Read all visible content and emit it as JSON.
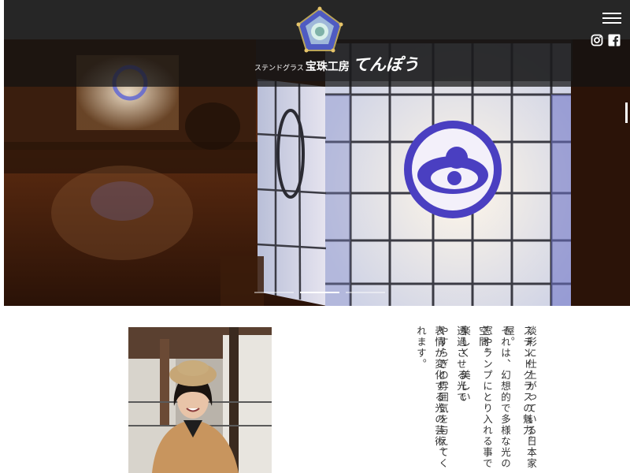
{
  "header": {
    "logo_small": "ステンドグラス",
    "logo_mid": "宝珠工房",
    "logo_big": "てんぽう",
    "menu_icon": "hamburger-menu-icon",
    "social": {
      "instagram_icon": "instagram-icon",
      "facebook_icon": "facebook-icon"
    }
  },
  "hero": {
    "slides_total": 3,
    "active_slide": 2
  },
  "content": {
    "paragraph_1": [
      "ステンドグラスの魅力。",
      "それは、幻想的で多様な光の空間。",
      "透過させる光で",
      "表情が変化する光の芸術。"
    ],
    "paragraph_2": [
      "淡彩に仕上がっている日本家屋。",
      "窓やランプにとり入れる事で",
      "楽しく　美しい",
      "やすらぎの雰囲気を与えてくれます。"
    ]
  },
  "colors": {
    "topbar": "#262626",
    "logo_blue": "#5a5fc9",
    "text": "#333333"
  }
}
